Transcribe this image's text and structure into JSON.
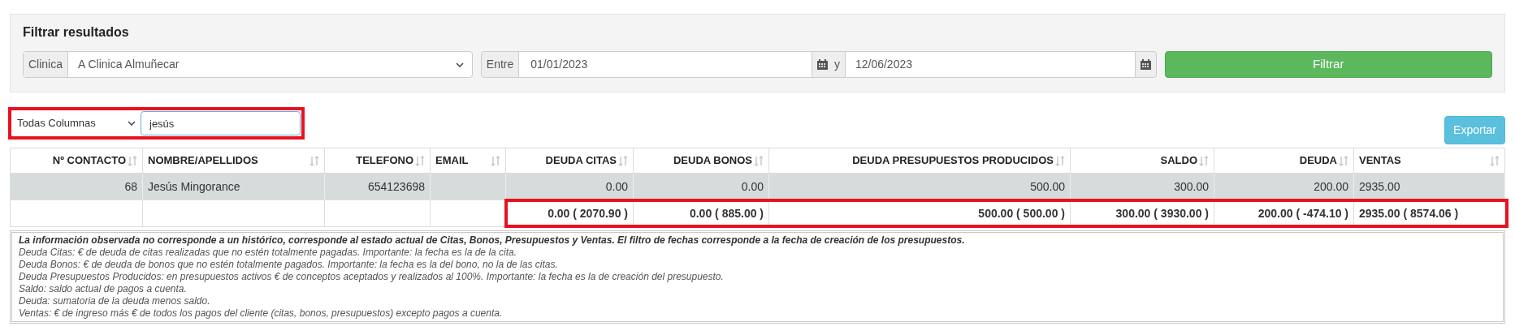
{
  "filter_panel": {
    "title": "Filtrar resultados",
    "clinic": {
      "label": "Clinica",
      "value": "A Clinica Almuñecar"
    },
    "date_range": {
      "label": "Entre",
      "from": "01/01/2023",
      "separator": "y",
      "to": "12/06/2023"
    },
    "button": "Filtrar"
  },
  "search": {
    "column": "Todas Columnas",
    "query": "jesús"
  },
  "export_button": "Exportar",
  "table": {
    "columns": [
      "Nº CONTACTO",
      "NOMBRE/APELLIDOS",
      "TELEFONO",
      "EMAIL",
      "DEUDA CITAS",
      "DEUDA BONOS",
      "DEUDA PRESUPUESTOS PRODUCIDOS",
      "SALDO",
      "DEUDA",
      "VENTAS"
    ],
    "rows": [
      [
        "68",
        "Jesús Mingorance",
        "654123698",
        null,
        "0.00",
        "0.00",
        "500.00",
        "300.00",
        "200.00",
        "2935.00"
      ]
    ],
    "totals": [
      "0.00 ( 2070.90 )",
      "0.00 ( 885.00 )",
      "500.00 ( 500.00 )",
      "300.00 ( 3930.00 )",
      "200.00 ( -474.10 )",
      "2935.00 ( 8574.06 )"
    ]
  },
  "notes": {
    "heading": "La información observada no corresponde a un histórico, corresponde al estado actual de Citas, Bonos, Presupuestos y Ventas. El filtro de fechas corresponde a la fecha de creación de los presupuestos.",
    "lines": [
      "Deuda Citas: € de deuda de citas realizadas que no estén totalmente pagadas. Importante: la fecha es la de la cita.",
      "Deuda Bonos: € de deuda de bonos que no estén totalmente pagados. Importante: la fecha es la del bono, no la de las citas.",
      "Deuda Presupuestos Producidos: en presupuestos activos € de conceptos aceptados y realizados al 100%. Importante: la fecha es la de creación del presupuesto.",
      "Saldo: saldo actual de pagos a cuenta.",
      "Deuda: sumatoria de la deuda menos saldo.",
      "Ventas: € de ingreso más € de todos los pagos del cliente (citas, bonos, presupuestos) excepto pagos a cuenta."
    ]
  }
}
